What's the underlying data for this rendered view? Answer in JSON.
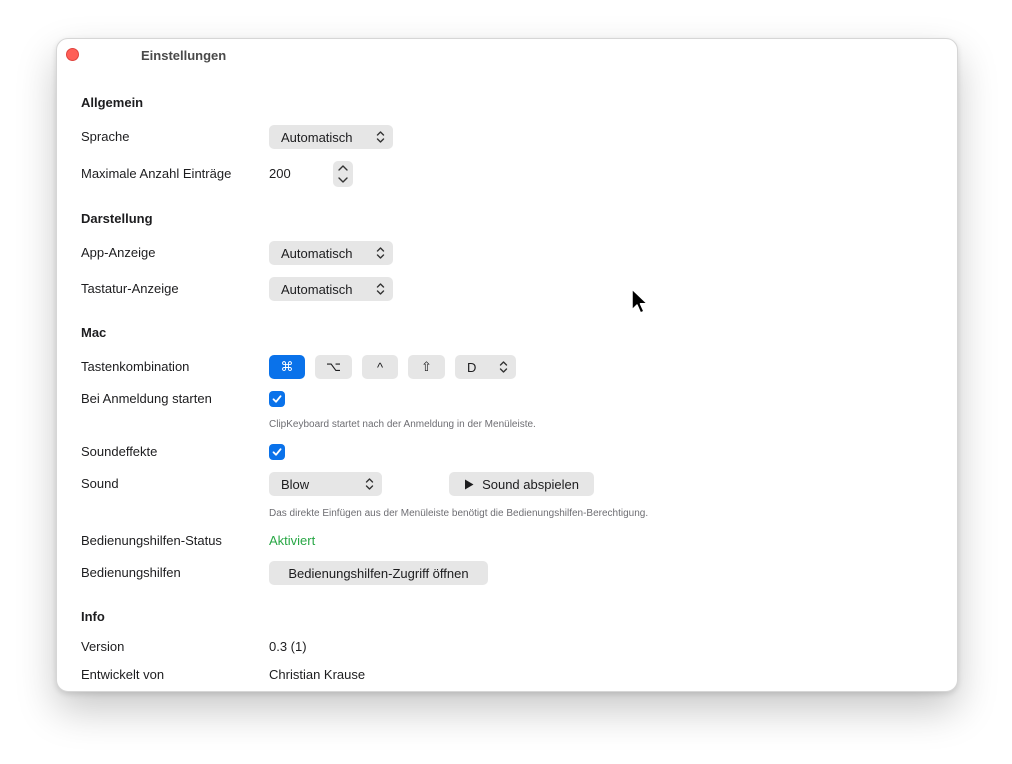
{
  "window": {
    "title": "Einstellungen"
  },
  "general": {
    "heading": "Allgemein",
    "language_label": "Sprache",
    "language_value": "Automatisch",
    "max_entries_label": "Maximale Anzahl Einträge",
    "max_entries_value": "200"
  },
  "appearance": {
    "heading": "Darstellung",
    "app_display_label": "App-Anzeige",
    "app_display_value": "Automatisch",
    "keyboard_display_label": "Tastatur-Anzeige",
    "keyboard_display_value": "Automatisch"
  },
  "mac": {
    "heading": "Mac",
    "shortcut_label": "Tastenkombination",
    "shortcut_keys": {
      "command": "⌘",
      "option": "⌥",
      "control": "^",
      "shift": "⇧",
      "key": "D"
    },
    "launch_label": "Bei Anmeldung starten",
    "launch_checked": true,
    "launch_hint": "ClipKeyboard startet nach der Anmeldung in der Menüleiste.",
    "sound_effects_label": "Soundeffekte",
    "sound_effects_checked": true,
    "sound_label": "Sound",
    "sound_value": "Blow",
    "play_sound_label": "Sound abspielen",
    "paste_hint": "Das direkte Einfügen aus der Menüleiste benötigt die Bedienungshilfen-Berechtigung.",
    "accessibility_status_label": "Bedienungshilfen-Status",
    "accessibility_status_value": "Aktiviert",
    "accessibility_label": "Bedienungshilfen",
    "accessibility_button": "Bedienungshilfen-Zugriff öffnen"
  },
  "info": {
    "heading": "Info",
    "version_label": "Version",
    "version_value": "0.3 (1)",
    "developer_label": "Entwickelt von",
    "developer_value": "Christian Krause"
  },
  "colors": {
    "accent": "#0a72ea",
    "status_active": "#28a745",
    "close_button": "#ff5f57"
  },
  "icons": [
    "close-icon",
    "chevron-updown-icon",
    "stepper-icon",
    "checkmark-icon",
    "play-icon",
    "pointer-cursor-icon"
  ]
}
